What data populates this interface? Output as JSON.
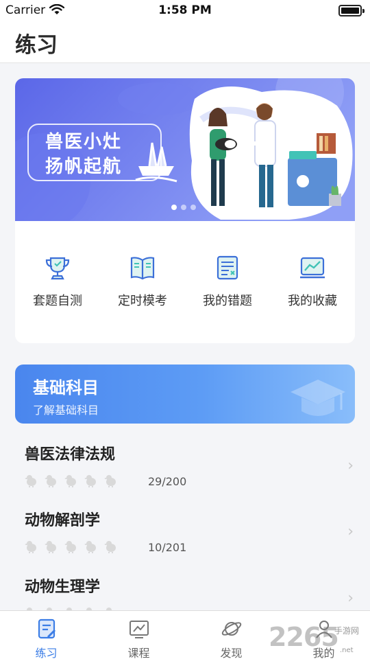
{
  "status_bar": {
    "carrier": "Carrier",
    "time": "1:58 PM",
    "battery_level": 1.0
  },
  "nav": {
    "title": "练习"
  },
  "banner": {
    "line1": "兽医小灶",
    "line2": "扬帆起航",
    "dot_count": 3,
    "active_dot": 0,
    "colors": {
      "bg_start": "#5b67e8",
      "bg_end": "#8f9ff6"
    }
  },
  "quick_actions": [
    {
      "label": "套题自测",
      "icon": "trophy-icon"
    },
    {
      "label": "定时模考",
      "icon": "open-book-icon"
    },
    {
      "label": "我的错题",
      "icon": "notes-icon"
    },
    {
      "label": "我的收藏",
      "icon": "chart-monitor-icon"
    }
  ],
  "subject": {
    "title": "基础科目",
    "subtitle": "了解基础科目",
    "icon": "graduation-cap-icon"
  },
  "courses": [
    {
      "name": "兽医法律法规",
      "count": "29/200",
      "stars": 5
    },
    {
      "name": "动物解剖学",
      "count": "10/201",
      "stars": 5
    },
    {
      "name": "动物生理学",
      "count": "",
      "stars": 5
    }
  ],
  "tabs": [
    {
      "label": "练习",
      "icon": "practice-icon",
      "active": true
    },
    {
      "label": "课程",
      "icon": "course-icon",
      "active": false
    },
    {
      "label": "发现",
      "icon": "planet-icon",
      "active": false
    },
    {
      "label": "我的",
      "icon": "user-icon",
      "active": false
    }
  ],
  "watermark": {
    "text": "2265",
    "label": "手游网",
    "url": ".net"
  },
  "accent_color": "#3b7de6"
}
